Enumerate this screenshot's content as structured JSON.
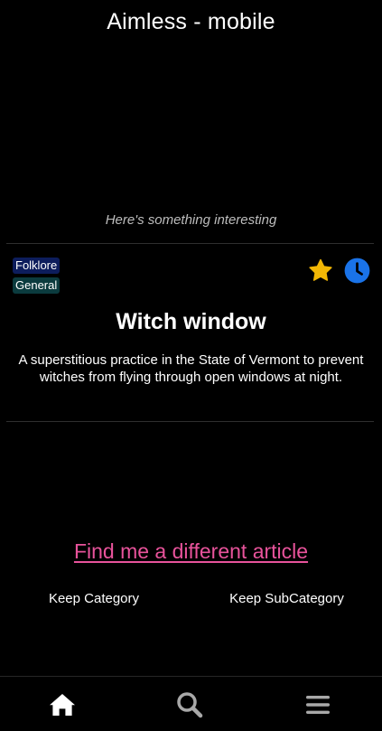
{
  "app": {
    "title": "Aimless - mobile"
  },
  "intro": {
    "text": "Here's something interesting"
  },
  "article": {
    "category": "Folklore",
    "subcategory": "General",
    "title": "Witch window",
    "description": "A superstitious practice in the State of Vermont to prevent witches from flying through open windows at night.",
    "favorite_icon": "star-icon",
    "later_icon": "clock-icon"
  },
  "actions": {
    "find_different": "Find me a different article",
    "keep_category": "Keep Category",
    "keep_subcategory": "Keep SubCategory"
  },
  "nav": {
    "items": [
      {
        "name": "home",
        "icon": "home-icon"
      },
      {
        "name": "search",
        "icon": "search-icon"
      },
      {
        "name": "menu",
        "icon": "menu-icon"
      }
    ]
  },
  "colors": {
    "background": "#000000",
    "link": "#e8539b",
    "star": "#f2b705",
    "clock": "#1a73e8",
    "category_tag": "#0d1d5c",
    "subcategory_tag": "#0b3b3e",
    "nav_icon_active": "#ffffff",
    "nav_icon_inactive": "#a8a8a8"
  }
}
